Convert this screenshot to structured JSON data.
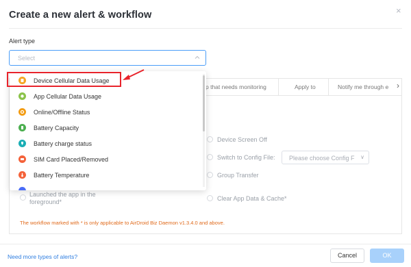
{
  "dialog": {
    "title": "Create a new alert & workflow",
    "close_glyph": "×"
  },
  "alert_type": {
    "label": "Alert type",
    "placeholder": "Select",
    "options": [
      {
        "label": "Device Cellular Data Usage",
        "icon": "cellular-data-icon",
        "color": "#f5a623",
        "highlighted": true
      },
      {
        "label": "App Cellular Data Usage",
        "icon": "app-data-icon",
        "color": "#8bc34a"
      },
      {
        "label": "Online/Offline Status",
        "icon": "status-icon",
        "color": "#f39c12"
      },
      {
        "label": "Battery Capacity",
        "icon": "battery-icon",
        "color": "#4caf50"
      },
      {
        "label": "Battery charge status",
        "icon": "charge-icon",
        "color": "#1aaeb5"
      },
      {
        "label": "SIM Card Placed/Removed",
        "icon": "sim-card-icon",
        "color": "#f4623a"
      },
      {
        "label": "Battery Temperature",
        "icon": "temperature-icon",
        "color": "#f4623a"
      }
    ]
  },
  "tabs": [
    {
      "label": "p that needs monitoring"
    },
    {
      "label": "Apply to"
    },
    {
      "label": "Notify me through e"
    }
  ],
  "tabs_next_glyph": "›",
  "actions": {
    "device_screen_off": "Device Screen Off",
    "switch_config": "Switch to Config File:",
    "config_placeholder": "Please choose Config F",
    "group_transfer": "Group Transfer",
    "launched_app_line1": "Launched the app in the",
    "launched_app_line2": "foreground*",
    "clear_app_data": "Clear App Data & Cache*"
  },
  "footnote": "The workflow marked with * is only applicable to AirDroid Biz Daemon v1.3.4.0 and above.",
  "footer": {
    "help_link": "Need more types of alerts?",
    "cancel": "Cancel",
    "ok": "OK"
  },
  "colors": {
    "primary": "#4a9df8",
    "highlight_border": "#e8232b",
    "footnote": "#e06a1b",
    "link": "#2f7ee0",
    "ok_disabled": "#a8d1fb"
  }
}
